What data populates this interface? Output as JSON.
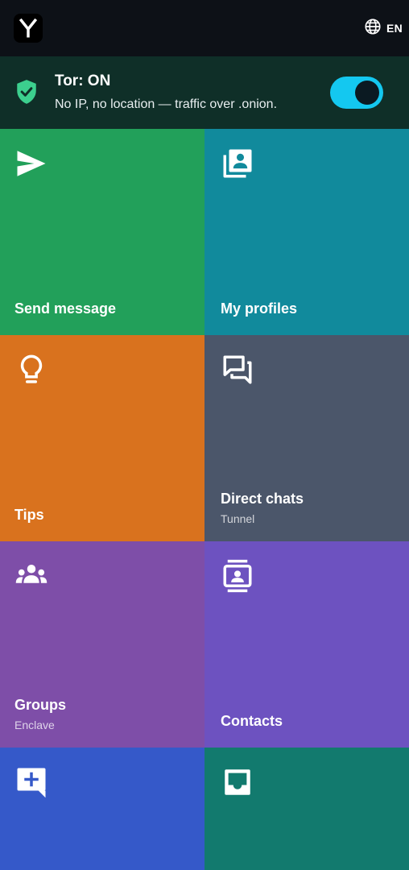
{
  "header": {
    "logo_icon": "y-logo-icon",
    "language_icon": "globe-icon",
    "language": "EN"
  },
  "tor": {
    "icon": "shield-check-icon",
    "title": "Tor: ON",
    "subtitle": "No IP, no location — traffic over .onion.",
    "toggle_on": true
  },
  "tiles": [
    {
      "label": "Send message",
      "subtitle": "",
      "icon": "send-icon",
      "color": "#22a05a"
    },
    {
      "label": "My profiles",
      "subtitle": "",
      "icon": "profiles-icon",
      "color": "#118a9c"
    },
    {
      "label": "Tips",
      "subtitle": "",
      "icon": "lightbulb-icon",
      "color": "#d9721e"
    },
    {
      "label": "Direct chats",
      "subtitle": "Tunnel",
      "icon": "chat-bubbles-icon",
      "color": "#4b566a"
    },
    {
      "label": "Groups",
      "subtitle": "Enclave",
      "icon": "groups-icon",
      "color": "#7e4ea8"
    },
    {
      "label": "Contacts",
      "subtitle": "",
      "icon": "contacts-icon",
      "color": "#6d52c0"
    },
    {
      "label": "",
      "subtitle": "",
      "icon": "add-comment-icon",
      "color": "#3559c9"
    },
    {
      "label": "",
      "subtitle": "",
      "icon": "inbox-icon",
      "color": "#127a6e"
    }
  ],
  "colors": {
    "background": "#0d1117",
    "tor_banner": "#0f2f28",
    "shield": "#3ccf8e",
    "toggle": "#14c8f0"
  }
}
